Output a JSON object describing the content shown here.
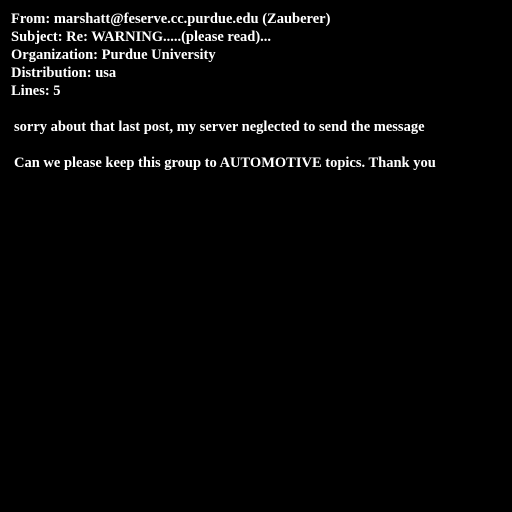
{
  "headers": {
    "from": "From: marshatt@feserve.cc.purdue.edu (Zauberer)",
    "subject": "Subject: Re: WARNING.....(please read)...",
    "organization": "Organization: Purdue University",
    "distribution": "Distribution: usa",
    "lines": "Lines: 5"
  },
  "body": {
    "paragraphs": [
      "sorry about that last post, my server neglected to send the message",
      "Can we please keep this group to AUTOMOTIVE topics. Thank you"
    ]
  },
  "colors": {
    "background": "#000000",
    "text": "#ffffff"
  }
}
